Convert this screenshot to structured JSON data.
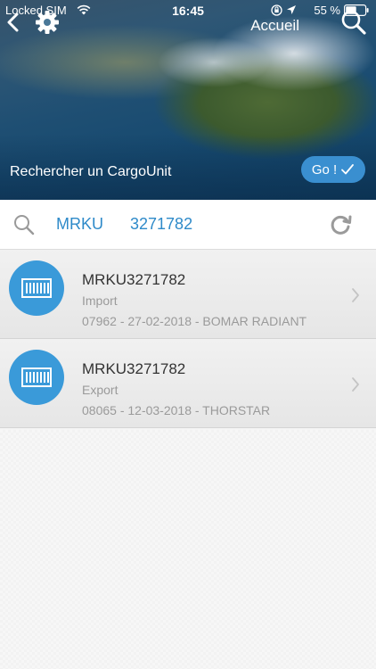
{
  "status_bar": {
    "carrier": "Locked SIM",
    "time": "16:45",
    "battery": "55 %"
  },
  "nav": {
    "title": "Accueil"
  },
  "hero": {
    "label": "Rechercher un CargoUnit",
    "go_label": "Go !"
  },
  "search": {
    "prefix": "MRKU",
    "number": "3271782"
  },
  "results": [
    {
      "title": "MRKU3271782",
      "type": "Import",
      "detail": "07962 - 27-02-2018 - BOMAR RADIANT"
    },
    {
      "title": "MRKU3271782",
      "type": "Export",
      "detail": "08065 - 12-03-2018 - THORSTAR"
    }
  ],
  "colors": {
    "accent": "#3a9ad9",
    "search_text": "#2e8ac9"
  }
}
